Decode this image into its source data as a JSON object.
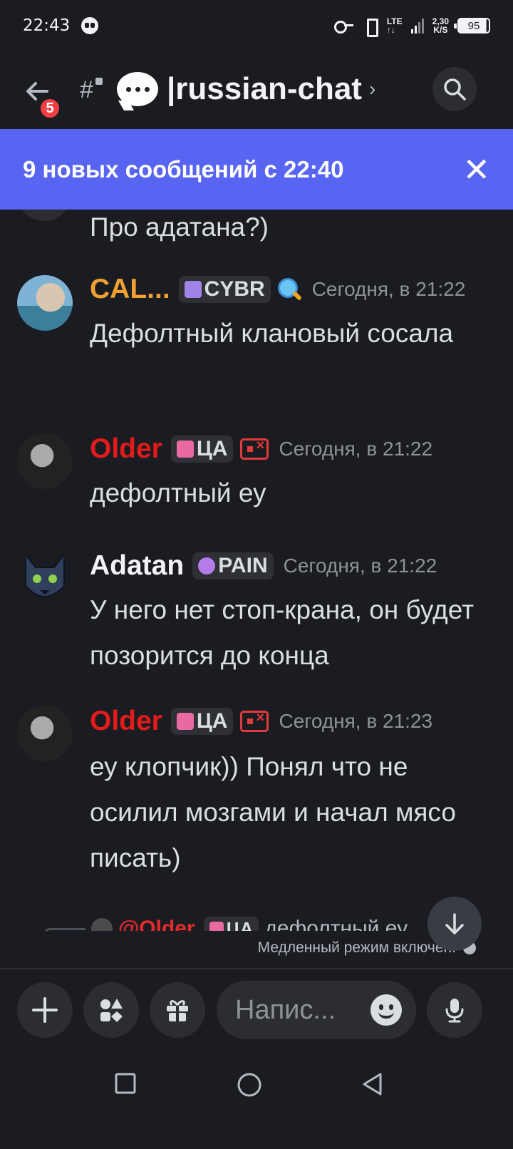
{
  "status_bar": {
    "time": "22:43",
    "network": "LTE",
    "speed_value": "2,30",
    "speed_unit": "K/S",
    "battery": "95"
  },
  "header": {
    "back_badge_count": "5",
    "channel_name": "|russian-chat",
    "chevron": "›"
  },
  "banner": {
    "text": "9 новых сообщений с 22:40",
    "close": "✕"
  },
  "partial_message": "Про адатана?)",
  "messages": [
    {
      "username": "CAL...",
      "username_color": "#f0a030",
      "tag": "CYBR",
      "timestamp": "Сегодня, в 21:22",
      "text": "Дефолтный клановый сосала"
    },
    {
      "username": "Older",
      "username_color": "#e31b1b",
      "tag": "ЦА",
      "timestamp": "Сегодня, в 21:22",
      "text": "дефолтный еу"
    },
    {
      "username": "Adatan",
      "username_color": "#f2f3f5",
      "tag": "PAIN",
      "timestamp": "Сегодня, в 21:22",
      "text": "У него нет стоп-крана, он будет позорится до конца"
    },
    {
      "username": "Older",
      "username_color": "#e31b1b",
      "tag": "ЦА",
      "timestamp": "Сегодня, в 21:23",
      "text": "еу клопчик)) Понял что не осилил мозгами и начал мясо писать)"
    }
  ],
  "reply_preview": {
    "mention": "@Older",
    "tag": "ЦА",
    "text": "дефолтный еу"
  },
  "slowmode": "Медленный режим включён.",
  "composer": {
    "placeholder": "Напис..."
  },
  "colors": {
    "banner": "#5865f2",
    "background": "#1b1c22",
    "badge": "#f23f43"
  }
}
